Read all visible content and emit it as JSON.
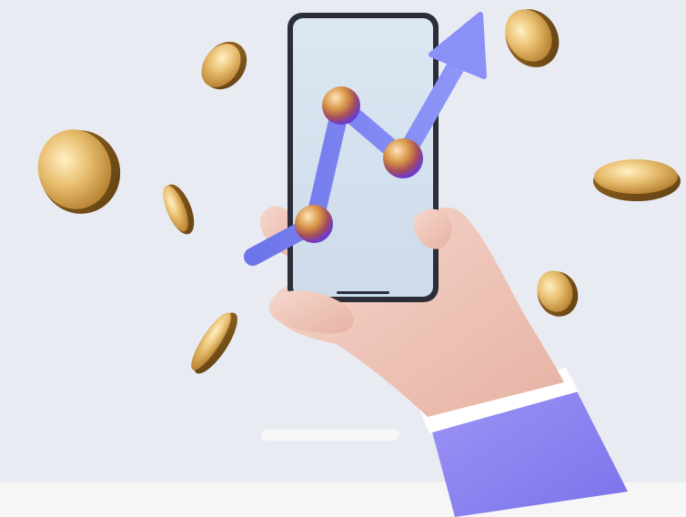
{
  "scene": {
    "subject": "",
    "colors": {
      "background": "#e9ebf2",
      "bottom_strip": "#f6f6f6",
      "pill": "#f8f8fa",
      "phone_frame": "#2b2e38",
      "phone_screen": "#d3e1ee",
      "arrow": "#7f86f2",
      "coin_gold": "#e0b15a",
      "hand_skin": "#f1c9bd",
      "sleeve": "#8f87f0",
      "cuff": "#ffffff"
    },
    "icons": {
      "phone": "smartphone-icon",
      "arrow": "trend-up-arrow-icon",
      "coin": "gold-coin-icon",
      "hand": "hand-icon"
    }
  }
}
